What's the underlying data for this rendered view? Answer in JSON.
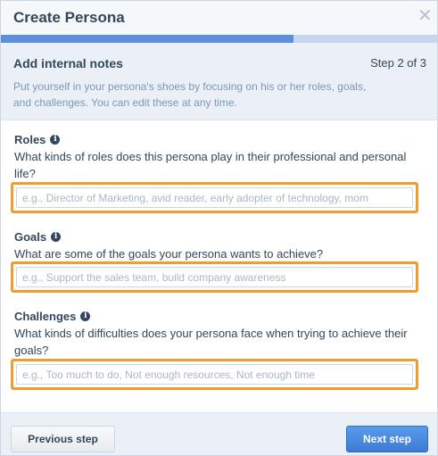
{
  "dialog": {
    "title": "Create Persona",
    "close_icon": "close-icon",
    "progress": {
      "current_step": 2,
      "total_steps": 3,
      "fill_fraction": 0.67
    }
  },
  "step": {
    "title": "Add internal notes",
    "count": "Step 2 of 3",
    "description": "Put yourself in your persona's shoes by focusing on his or her roles, goals, and challenges. You can edit these at any time."
  },
  "fields": {
    "roles": {
      "label": "Roles",
      "help": "What kinds of roles does this persona play in their professional and personal life?",
      "placeholder": "e.g., Director of Marketing, avid reader, early adopter of technology, mom",
      "value": ""
    },
    "goals": {
      "label": "Goals",
      "help": "What are some of the goals your persona wants to achieve?",
      "placeholder": "e.g., Support the sales team, build company awareness",
      "value": ""
    },
    "challenges": {
      "label": "Challenges",
      "help": "What kinds of difficulties does your persona face when trying to achieve their goals?",
      "placeholder": "e.g., Too much to do, Not enough resources, Not enough time",
      "value": ""
    }
  },
  "info_icon_glyph": "i",
  "footer": {
    "prev_label": "Previous step",
    "next_label": "Next step"
  },
  "colors": {
    "accent": "#f39c2d",
    "progress_fill": "#5e8fdc",
    "primary_button": "#3b7bd6"
  }
}
